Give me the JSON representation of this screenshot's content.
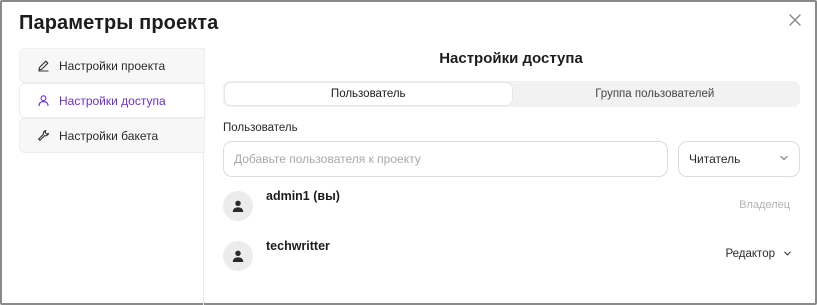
{
  "dialog": {
    "title": "Параметры проекта"
  },
  "sidebar": {
    "items": [
      {
        "label": "Настройки проекта",
        "icon": "pencil-icon",
        "active": false
      },
      {
        "label": "Настройки доступа",
        "icon": "user-icon",
        "active": true
      },
      {
        "label": "Настройки бакета",
        "icon": "wrench-icon",
        "active": false
      }
    ]
  },
  "panel": {
    "title": "Настройки доступа",
    "tabs": [
      {
        "label": "Пользователь",
        "active": true
      },
      {
        "label": "Группа пользователей",
        "active": false
      }
    ],
    "field_label": "Пользователь",
    "input": {
      "value": "",
      "placeholder": "Добавьте пользователя к проекту"
    },
    "role_select": {
      "value": "Читатель"
    },
    "members": [
      {
        "name": "admin1 (вы)",
        "role": "Владелец",
        "editable": false
      },
      {
        "name": "techwritter",
        "role": "Редактор",
        "editable": true
      }
    ]
  },
  "colors": {
    "accent": "#6b2fd6",
    "muted": "#b3b3b3",
    "border": "#8a8a8a"
  }
}
